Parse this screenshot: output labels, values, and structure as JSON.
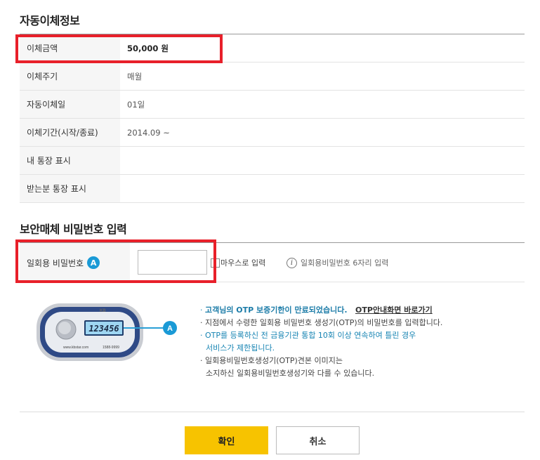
{
  "sections": {
    "transfer_info_title": "자동이체정보",
    "security_title": "보안매체 비밀번호 입력"
  },
  "transfer_info": {
    "rows": [
      {
        "label": "이체금액",
        "value": "50,000 원"
      },
      {
        "label": "이체주기",
        "value": "매월"
      },
      {
        "label": "자동이체일",
        "value": "01일"
      },
      {
        "label": "이체기간(시작/종료)",
        "value": "2014.09 ~"
      },
      {
        "label": "내 통장 표시",
        "value": ""
      },
      {
        "label": "받는분 통장 표시",
        "value": ""
      }
    ]
  },
  "otp": {
    "label": "일회용 비밀번호",
    "badge": "A",
    "input_value": "",
    "mouse_input_label": "마우스로 입력",
    "hint": "일회용비밀번호 6자리 입력",
    "device_display": "123456",
    "device_badge": "A",
    "device_brand": "KB",
    "device_url": "www.kbstar.com",
    "device_phone": "1588-9999"
  },
  "notes": {
    "expired": "고객님의 OTP 보증기한이 만료되었습니다.",
    "otp_guide_link": "OTP안내화면 바로가기",
    "note2": "지점에서 수령한 일회용 비밀번호 생성기(OTP)의 비밀번호를 입력합니다.",
    "note3_line1": "OTP를 등록하신 전 금융기관 통합 10회 이상 연속하여 틀린 경우",
    "note3_line2": "서비스가 제한됩니다.",
    "note4_line1": "일회용비밀번호생성기(OTP)견본 이미지는",
    "note4_line2": "소지하신 일회용비밀번호생성기와 다를 수 있습니다."
  },
  "buttons": {
    "confirm": "확인",
    "cancel": "취소"
  },
  "colors": {
    "highlight": "#e8202a",
    "confirm_bg": "#f7c300",
    "badge": "#1a9ad6"
  }
}
